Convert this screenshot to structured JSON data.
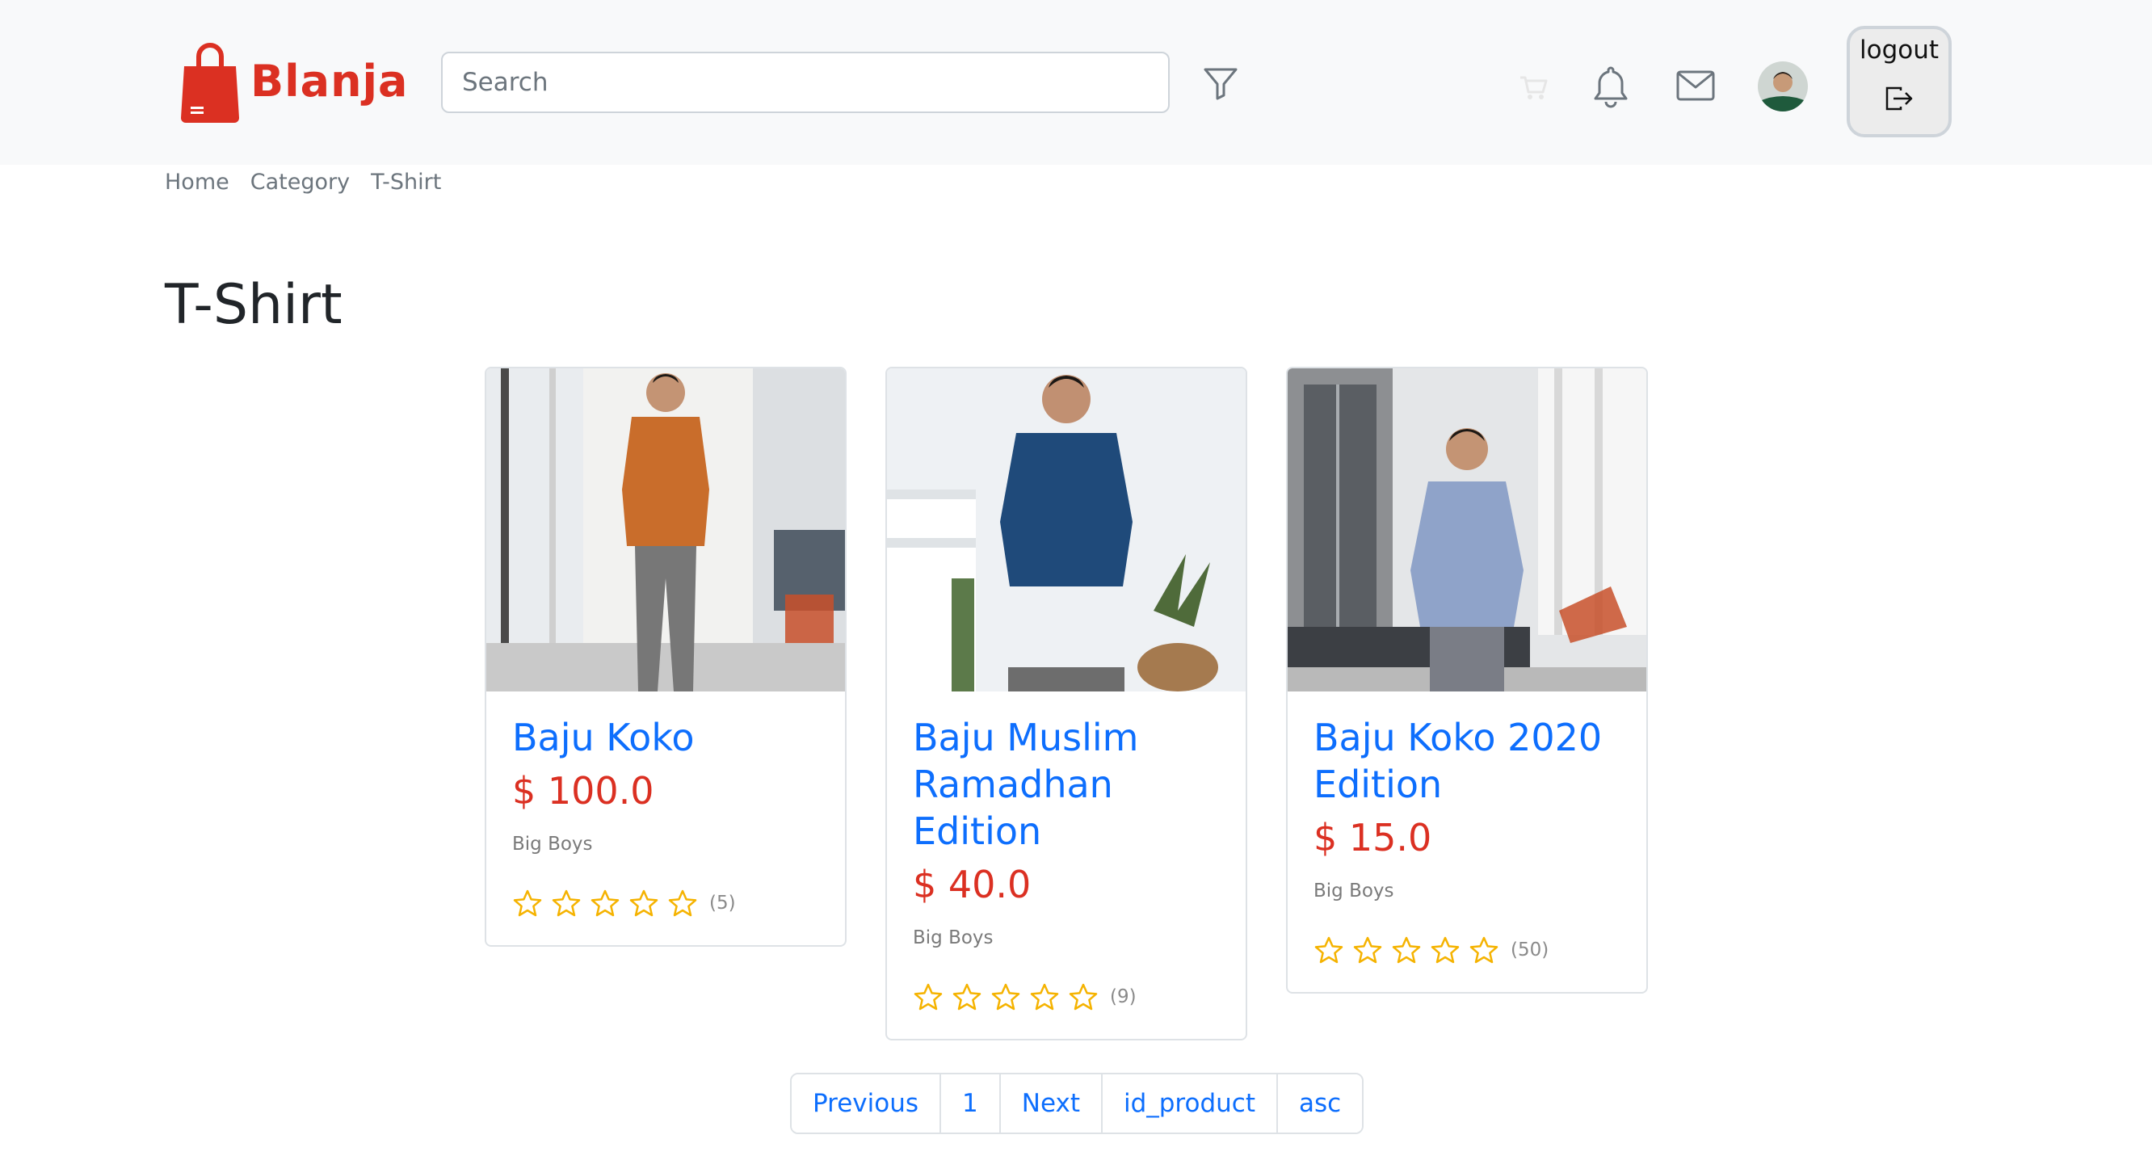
{
  "header": {
    "brand": "Blanja",
    "search_placeholder": "Search",
    "logout_label": "logout"
  },
  "breadcrumb": [
    "Home",
    "Category",
    "T-Shirt"
  ],
  "page_title": "T-Shirt",
  "products": [
    {
      "name": "Baju Koko",
      "price": "$ 100.0",
      "store": "Big Boys",
      "rating_count": "(5)",
      "stars": 5,
      "shirt_color": "#c96d2b"
    },
    {
      "name": "Baju Muslim Ramadhan Edition",
      "price": "$ 40.0",
      "store": "Big Boys",
      "rating_count": "(9)",
      "stars": 5,
      "shirt_color": "#1f4a7a"
    },
    {
      "name": "Baju Koko 2020 Edition",
      "price": "$ 15.0",
      "store": "Big Boys",
      "rating_count": "(50)",
      "stars": 5,
      "shirt_color": "#8fa3c9"
    }
  ],
  "pagination": {
    "previous": "Previous",
    "page": "1",
    "next": "Next",
    "sort_field": "id_product",
    "sort_order": "asc"
  },
  "colors": {
    "brand": "#db3022",
    "link": "#0d6efd",
    "star": "#f5b301"
  }
}
